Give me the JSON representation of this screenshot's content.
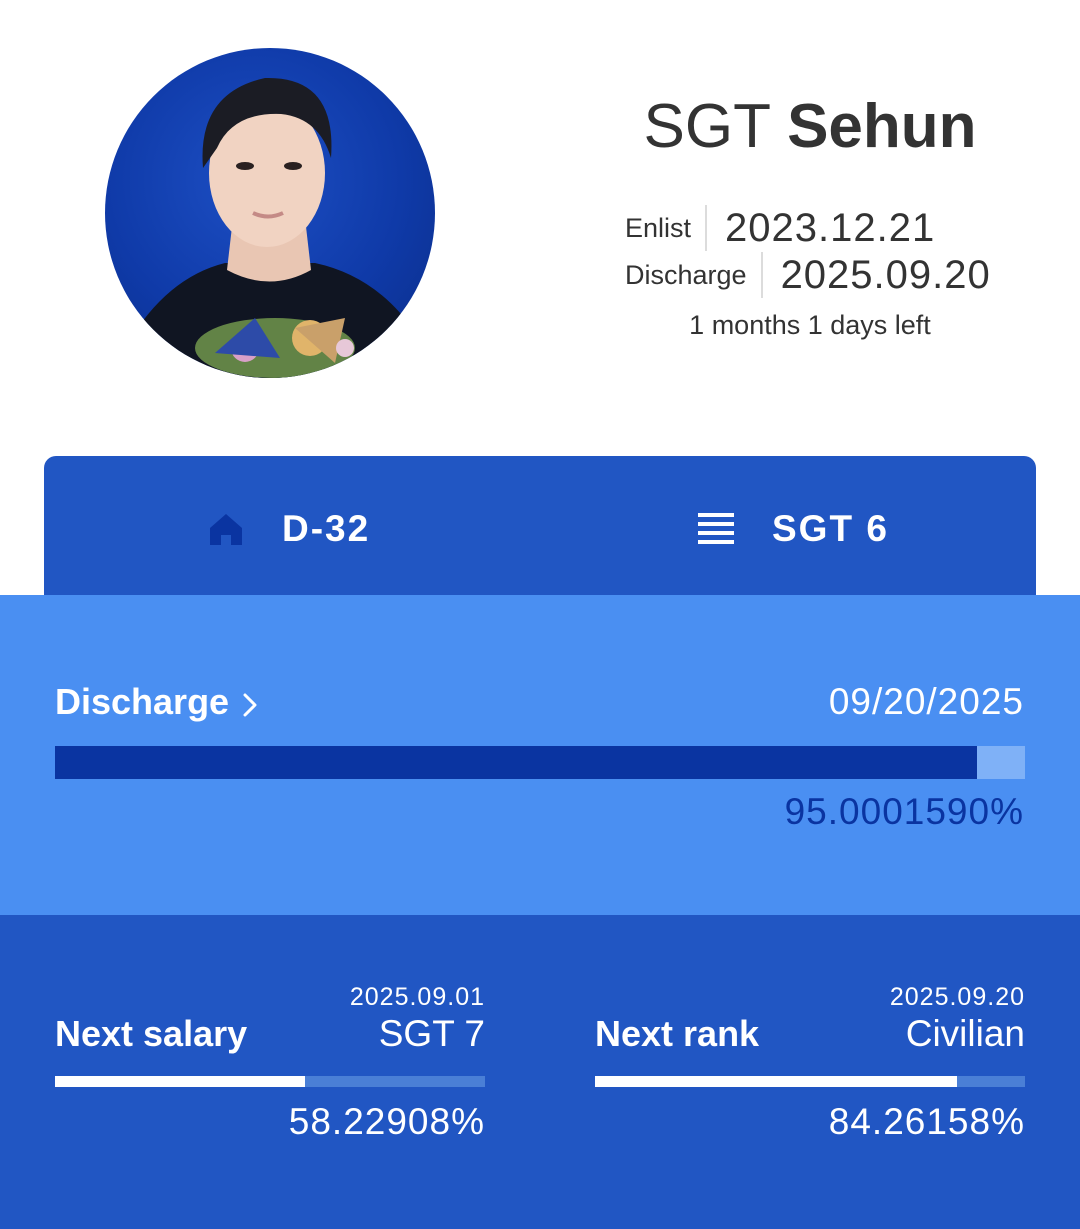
{
  "profile": {
    "rank": "SGT",
    "name": "Sehun",
    "enlist_label": "Enlist",
    "enlist_date": "2023.12.21",
    "discharge_label": "Discharge",
    "discharge_date": "2025.09.20",
    "time_left": "1 months 1 days left"
  },
  "tabs": [
    {
      "label": "D-32",
      "icon": "home-icon"
    },
    {
      "label": "SGT 6",
      "icon": "menu-icon"
    }
  ],
  "discharge": {
    "title": "Discharge",
    "date": "09/20/2025",
    "percent_text": "95.0001590%",
    "progress": 0.95000159
  },
  "next_salary": {
    "title": "Next salary",
    "date": "2025.09.01",
    "value": "SGT 7",
    "percent_text": "58.22908%",
    "progress": 0.5822908
  },
  "next_rank": {
    "title": "Next rank",
    "date": "2025.09.20",
    "value": "Civilian",
    "percent_text": "84.26158%",
    "progress": 0.8426158
  },
  "colors": {
    "tab_bar": "#2156c3",
    "discharge_panel": "#4a8ff2",
    "discharge_fill": "#0a34a1",
    "home_icon": "#0a34a1"
  }
}
